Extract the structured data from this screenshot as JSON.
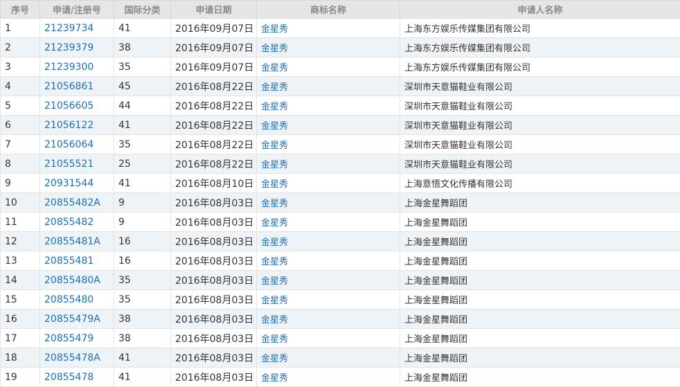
{
  "headers": {
    "index": "序号",
    "reg_no": "申请/注册号",
    "intl_class": "国际分类",
    "apply_date": "申请日期",
    "trademark_name": "商标名称",
    "applicant": "申请人名称"
  },
  "rows": [
    {
      "index": "1",
      "reg_no": "21239734",
      "intl_class": "41",
      "apply_date": "2016年09月07日",
      "trademark_name": "金星秀",
      "applicant": "上海东方娱乐传媒集团有限公司"
    },
    {
      "index": "2",
      "reg_no": "21239379",
      "intl_class": "38",
      "apply_date": "2016年09月07日",
      "trademark_name": "金星秀",
      "applicant": "上海东方娱乐传媒集团有限公司"
    },
    {
      "index": "3",
      "reg_no": "21239300",
      "intl_class": "35",
      "apply_date": "2016年09月07日",
      "trademark_name": "金星秀",
      "applicant": "上海东方娱乐传媒集团有限公司"
    },
    {
      "index": "4",
      "reg_no": "21056861",
      "intl_class": "45",
      "apply_date": "2016年08月22日",
      "trademark_name": "金星秀",
      "applicant": "深圳市天意猫鞋业有限公司"
    },
    {
      "index": "5",
      "reg_no": "21056605",
      "intl_class": "44",
      "apply_date": "2016年08月22日",
      "trademark_name": "金星秀",
      "applicant": "深圳市天意猫鞋业有限公司"
    },
    {
      "index": "6",
      "reg_no": "21056122",
      "intl_class": "41",
      "apply_date": "2016年08月22日",
      "trademark_name": "金星秀",
      "applicant": "深圳市天意猫鞋业有限公司"
    },
    {
      "index": "7",
      "reg_no": "21056064",
      "intl_class": "35",
      "apply_date": "2016年08月22日",
      "trademark_name": "金星秀",
      "applicant": "深圳市天意猫鞋业有限公司"
    },
    {
      "index": "8",
      "reg_no": "21055521",
      "intl_class": "25",
      "apply_date": "2016年08月22日",
      "trademark_name": "金星秀",
      "applicant": "深圳市天意猫鞋业有限公司"
    },
    {
      "index": "9",
      "reg_no": "20931544",
      "intl_class": "41",
      "apply_date": "2016年08月10日",
      "trademark_name": "金星秀",
      "applicant": "上海意悟文化传播有限公司"
    },
    {
      "index": "10",
      "reg_no": "20855482A",
      "intl_class": "9",
      "apply_date": "2016年08月03日",
      "trademark_name": "金星秀",
      "applicant": "上海金星舞蹈团"
    },
    {
      "index": "11",
      "reg_no": "20855482",
      "intl_class": "9",
      "apply_date": "2016年08月03日",
      "trademark_name": "金星秀",
      "applicant": "上海金星舞蹈团"
    },
    {
      "index": "12",
      "reg_no": "20855481A",
      "intl_class": "16",
      "apply_date": "2016年08月03日",
      "trademark_name": "金星秀",
      "applicant": "上海金星舞蹈团"
    },
    {
      "index": "13",
      "reg_no": "20855481",
      "intl_class": "16",
      "apply_date": "2016年08月03日",
      "trademark_name": "金星秀",
      "applicant": "上海金星舞蹈团"
    },
    {
      "index": "14",
      "reg_no": "20855480A",
      "intl_class": "35",
      "apply_date": "2016年08月03日",
      "trademark_name": "金星秀",
      "applicant": "上海金星舞蹈团"
    },
    {
      "index": "15",
      "reg_no": "20855480",
      "intl_class": "35",
      "apply_date": "2016年08月03日",
      "trademark_name": "金星秀",
      "applicant": "上海金星舞蹈团"
    },
    {
      "index": "16",
      "reg_no": "20855479A",
      "intl_class": "38",
      "apply_date": "2016年08月03日",
      "trademark_name": "金星秀",
      "applicant": "上海金星舞蹈团"
    },
    {
      "index": "17",
      "reg_no": "20855479",
      "intl_class": "38",
      "apply_date": "2016年08月03日",
      "trademark_name": "金星秀",
      "applicant": "上海金星舞蹈团"
    },
    {
      "index": "18",
      "reg_no": "20855478A",
      "intl_class": "41",
      "apply_date": "2016年08月03日",
      "trademark_name": "金星秀",
      "applicant": "上海金星舞蹈团"
    },
    {
      "index": "19",
      "reg_no": "20855478",
      "intl_class": "41",
      "apply_date": "2016年08月03日",
      "trademark_name": "金星秀",
      "applicant": "上海金星舞蹈团"
    }
  ],
  "colors": {
    "header_bg": "#e6e6e6",
    "header_text": "#8a8a8a",
    "link": "#1a6fb5",
    "row_alt_bg": "#eef3f8",
    "text": "#333333"
  }
}
